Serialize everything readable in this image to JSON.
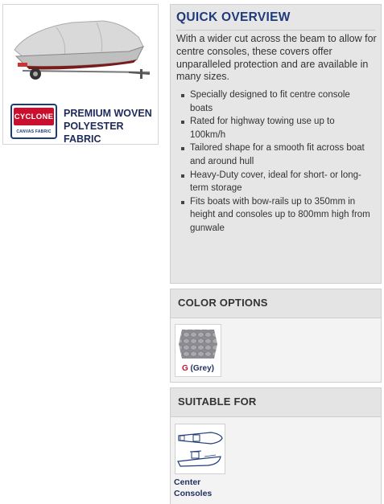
{
  "product_card": {
    "brand_logo_text": "CYCLONE",
    "brand_logo_subtext": "CANVAS FABRIC",
    "fabric_line1": "PREMIUM WOVEN",
    "fabric_line2": "POLYESTER FABRIC"
  },
  "overview": {
    "title": "QUICK OVERVIEW",
    "intro": "With a wider cut across the beam to allow for centre consoles, these covers offer unparalleled protection and are available in many sizes.",
    "features": [
      "Specially designed to fit centre console boats",
      "Rated for highway towing use up to 100km/h",
      "Tailored shape for a smooth fit across boat and around hull",
      "Heavy-Duty cover, ideal for short- or long-term storage",
      "Fits boats with bow-rails up to 350mm in height and consoles up to 800mm high from gunwale"
    ]
  },
  "color_options": {
    "title": "COLOR OPTIONS",
    "swatch_code": "G",
    "swatch_name": "(Grey)",
    "swatch_color": "#9a9a9f"
  },
  "suitable_for": {
    "title": "SUITABLE FOR",
    "label_line1": "Center",
    "label_line2": "Consoles"
  }
}
